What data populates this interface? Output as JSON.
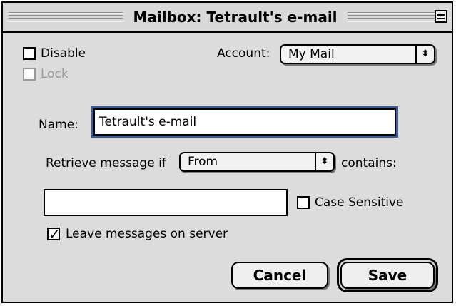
{
  "window": {
    "title": "Mailbox: Tetrault's e-mail"
  },
  "options": {
    "disable_label": "Disable",
    "disable_checked": false,
    "lock_label": "Lock",
    "lock_checked": false,
    "lock_enabled": false
  },
  "account": {
    "label": "Account:",
    "selected": "My Mail"
  },
  "name": {
    "label": "Name:",
    "value": "Tetrault's e-mail"
  },
  "rule": {
    "prefix": "Retrieve message if",
    "field_selected": "From",
    "suffix": "contains:",
    "match_value": ""
  },
  "case_sensitive": {
    "label": "Case Sensitive",
    "checked": false
  },
  "leave_on_server": {
    "label": "Leave messages on server",
    "checked": true
  },
  "buttons": {
    "cancel": "Cancel",
    "save": "Save"
  },
  "icons": {
    "popup_arrows": "⬍",
    "zoom": "zoom-box-icon"
  }
}
